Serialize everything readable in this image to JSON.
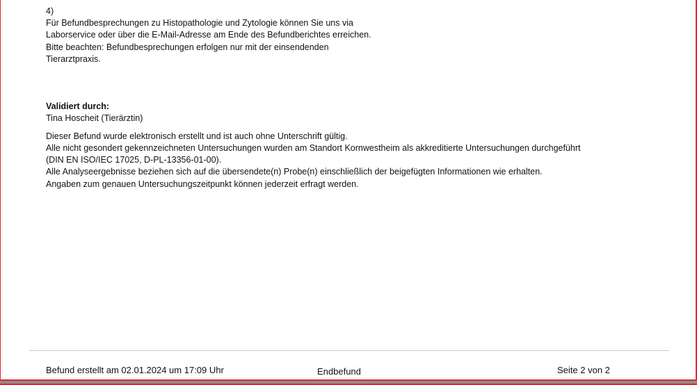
{
  "item_number": "4)",
  "discussion_paragraph": [
    "Für Befundbesprechungen zu Histopathologie und Zytologie können Sie uns via",
    "Laborservice oder über die E-Mail-Adresse am Ende des Befundberichtes erreichen.",
    "Bitte beachten: Befundbesprechungen erfolgen nur mit der einsendenden",
    "Tierarztpraxis."
  ],
  "validation": {
    "heading": "Validiert durch:",
    "name": "Tina Hoscheit (Tierärztin)"
  },
  "disclaimer": [
    "Dieser Befund wurde elektronisch erstellt und ist auch ohne Unterschrift gültig.",
    "Alle nicht gesondert gekennzeichneten Untersuchungen wurden am Standort Kornwestheim als akkreditierte Untersuchungen durchgeführt",
    "(DIN EN ISO/IEC 17025, D-PL-13356-01-00).",
    "Alle Analyseergebnisse beziehen sich auf die übersendete(n) Probe(n) einschließlich der beigefügten Informationen wie erhalten.",
    "Angaben zum genauen Untersuchungszeitpunkt können jederzeit erfragt werden."
  ],
  "footer": {
    "created": "Befund erstellt am 02.01.2024 um 17:09 Uhr",
    "status": "Endbefund",
    "page": "Seite 2 von 2"
  },
  "colors": {
    "frame": "#e2262b",
    "rule": "#c6c6c6"
  }
}
